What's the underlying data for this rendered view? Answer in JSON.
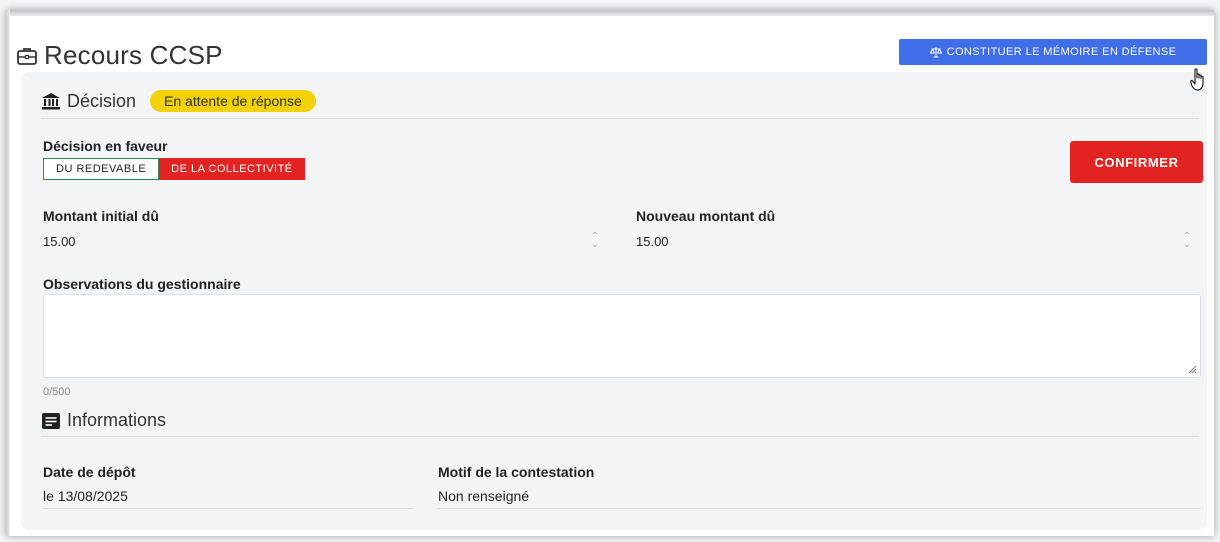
{
  "page": {
    "title": "Recours CCSP",
    "title_icon": "briefcase-icon"
  },
  "actions": {
    "memoire_label": "CONSTITUER LE MÉMOIRE EN DÉFENSE",
    "memoire_icon": "scale-icon"
  },
  "decision": {
    "heading": "Décision",
    "heading_icon": "bank-icon",
    "status": "En attente de réponse",
    "favor_label": "Décision en faveur",
    "options": [
      "DU REDEVABLE",
      "DE LA COLLECTIVITÉ"
    ],
    "confirm_label": "CONFIRMER",
    "initial_amount_label": "Montant initial dû",
    "initial_amount_value": "15.00",
    "new_amount_label": "Nouveau montant dû",
    "new_amount_value": "15.00",
    "observations_label": "Observations du gestionnaire",
    "observations_counter": "0/500"
  },
  "informations": {
    "heading": "Informations",
    "heading_icon": "notes-icon",
    "date_label": "Date de dépôt",
    "date_value": "le 13/08/2025",
    "motif_label": "Motif de la contestation",
    "motif_value": "Non renseigné"
  },
  "colors": {
    "primary": "#3f6ee8",
    "danger": "#e32321",
    "warning": "#f2d106",
    "success": "#2d8a59"
  }
}
